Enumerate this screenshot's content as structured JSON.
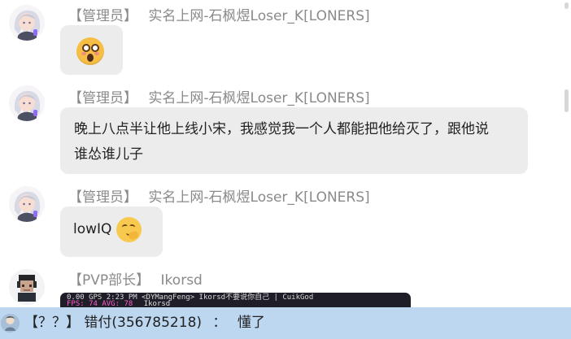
{
  "chat": {
    "messages": [
      {
        "role": "【管理员】",
        "name": "实名上网-石枫煜Loser_K[LONERS]",
        "emoji": "shocked-emoji"
      },
      {
        "role": "【管理员】",
        "name": "实名上网-石枫煜Loser_K[LONERS]",
        "text_line_1": "晚上八点半让他上线小宋，我感觉我一个人都能把他给灭了，跟他说",
        "text_line_2": "谁怂谁儿子"
      },
      {
        "role": "【管理员】",
        "name": "实名上网-石枫煜Loser_K[LONERS]",
        "text": "lowIQ",
        "emoji": "thinking-emoji"
      },
      {
        "role": "【PVP部长】",
        "name": "Ikorsd",
        "preview": {
          "top_line": "0.00  GPS  2:23 PM  <DYMangFeng>  Ikorsd不要说你自己 | CuikGod",
          "bottom_metrics": "FPS: 74  AVG: 78",
          "bottom_name": "Ikorsd"
        }
      }
    ]
  },
  "bottom_bar": {
    "prefix": "【？？】",
    "name": "错付(356785218)",
    "separator": "：",
    "message": "懂了"
  },
  "colors": {
    "bubble": "#ECECEC",
    "bottom_bar": "#BDD7F1",
    "sender_text": "#8A8A8A",
    "message_text": "#222222"
  },
  "icons": {
    "avatar_1": "anime-avatar",
    "avatar_2": "anime-avatar",
    "avatar_3": "anime-avatar",
    "avatar_4": "pixel-avatar",
    "bottom_avatar": "user-avatar"
  }
}
